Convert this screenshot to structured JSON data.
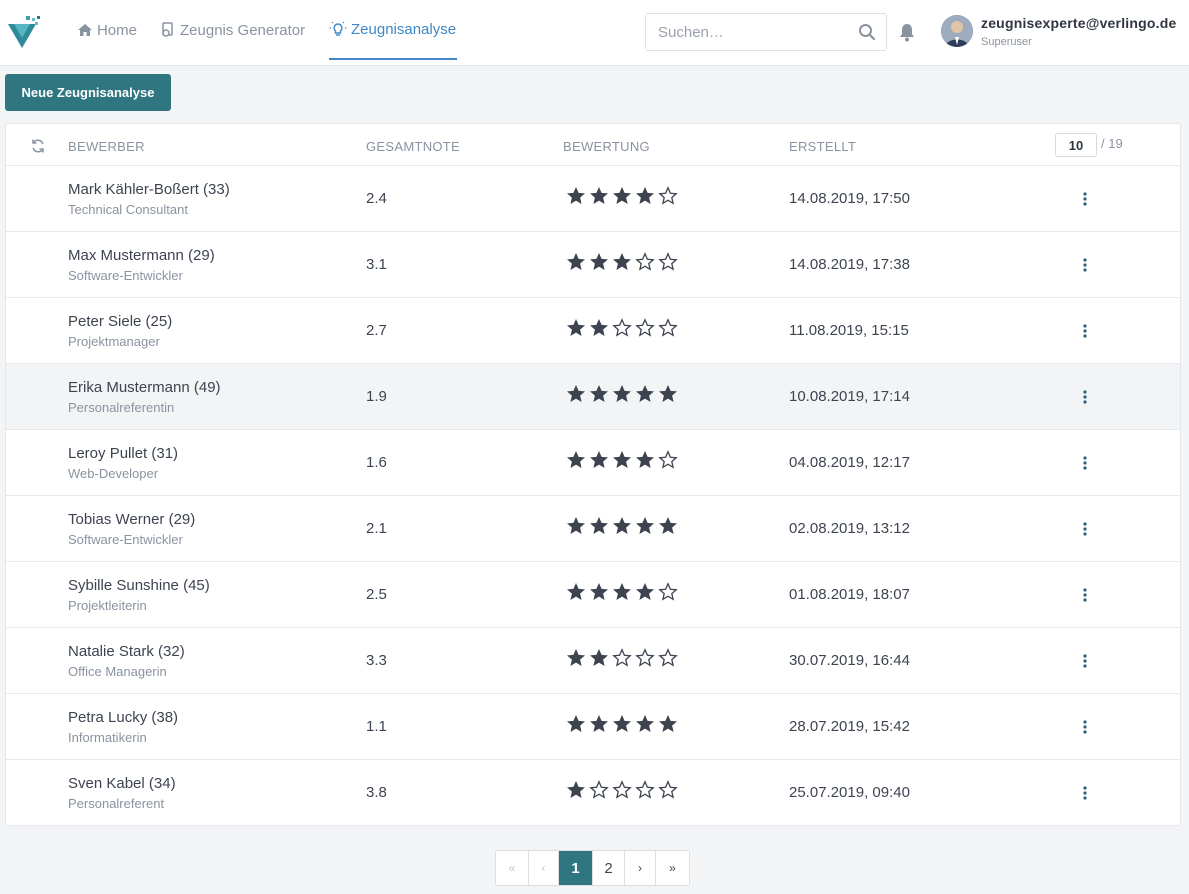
{
  "nav": {
    "home": "Home",
    "generator": "Zeugnis Generator",
    "analyse": "Zeugnisanalyse"
  },
  "search": {
    "placeholder": "Suchen…"
  },
  "user": {
    "email": "zeugnisexperte@verlingo.de",
    "role": "Superuser"
  },
  "actions": {
    "new_analysis": "Neue Zeugnisanalyse"
  },
  "table": {
    "headers": {
      "applicant": "BEWERBER",
      "grade": "GESAMTNOTE",
      "rating": "BEWERTUNG",
      "created": "ERSTELLT"
    },
    "per_page": "10",
    "total": "/ 19",
    "rows": [
      {
        "name": "Mark Kähler-Boßert (33)",
        "job": "Technical Consultant",
        "grade": "2.4",
        "stars": 4,
        "date": "14.08.2019, 17:50"
      },
      {
        "name": "Max Mustermann (29)",
        "job": "Software-Entwickler",
        "grade": "3.1",
        "stars": 3,
        "date": "14.08.2019, 17:38"
      },
      {
        "name": "Peter Siele (25)",
        "job": "Projektmanager",
        "grade": "2.7",
        "stars": 2,
        "date": "11.08.2019, 15:15"
      },
      {
        "name": "Erika Mustermann (49)",
        "job": "Personalreferentin",
        "grade": "1.9",
        "stars": 5,
        "date": "10.08.2019, 17:14"
      },
      {
        "name": "Leroy Pullet (31)",
        "job": "Web-Developer",
        "grade": "1.6",
        "stars": 4,
        "date": "04.08.2019, 12:17"
      },
      {
        "name": "Tobias Werner (29)",
        "job": "Software-Entwickler",
        "grade": "2.1",
        "stars": 5,
        "date": "02.08.2019, 13:12"
      },
      {
        "name": "Sybille Sunshine (45)",
        "job": "Projektleiterin",
        "grade": "2.5",
        "stars": 4,
        "date": "01.08.2019, 18:07"
      },
      {
        "name": "Natalie Stark (32)",
        "job": "Office Managerin",
        "grade": "3.3",
        "stars": 2,
        "date": "30.07.2019, 16:44"
      },
      {
        "name": "Petra Lucky (38)",
        "job": "Informatikerin",
        "grade": "1.1",
        "stars": 5,
        "date": "28.07.2019, 15:42"
      },
      {
        "name": "Sven Kabel (34)",
        "job": "Personalreferent",
        "grade": "3.8",
        "stars": 1,
        "date": "25.07.2019, 09:40"
      }
    ],
    "highlighted_row": 3
  },
  "pagination": {
    "first": "«",
    "prev": "‹",
    "pages": [
      "1",
      "2"
    ],
    "current": "1",
    "next": "›",
    "last": "»"
  },
  "colors": {
    "accent": "#2f7681",
    "nav_active": "#3f88c5",
    "star": "#3d4450"
  }
}
